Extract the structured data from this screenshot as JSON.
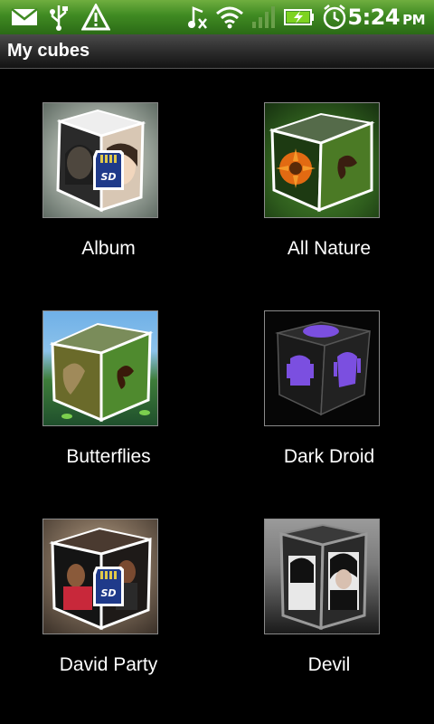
{
  "status_bar": {
    "time": "5:24",
    "ampm": "PM",
    "icons": [
      "mail-icon",
      "usb-icon",
      "warning-icon",
      "music-off-icon",
      "wifi-icon",
      "signal-icon",
      "battery-charging-icon",
      "alarm-icon"
    ]
  },
  "title": "My cubes",
  "cubes": [
    {
      "label": "Album",
      "sd": true
    },
    {
      "label": "All Nature",
      "sd": false
    },
    {
      "label": "Butterflies",
      "sd": false
    },
    {
      "label": "Dark Droid",
      "sd": false
    },
    {
      "label": "David Party",
      "sd": true
    },
    {
      "label": "Devil",
      "sd": false
    }
  ]
}
